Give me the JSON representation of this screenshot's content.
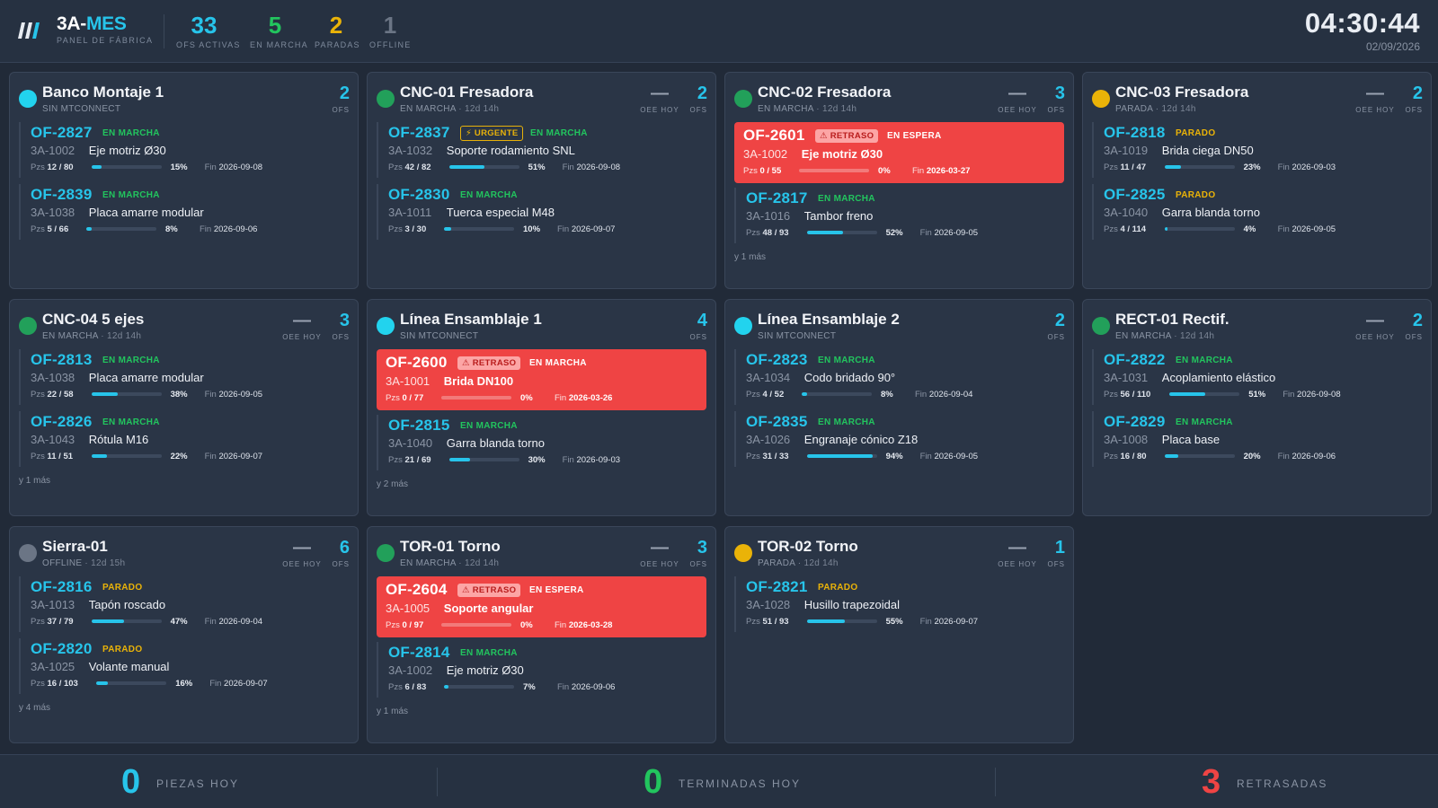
{
  "header": {
    "brand_prefix": "3A-",
    "brand_suffix": "MES",
    "subtitle": "PANEL DE FÁBRICA",
    "stats": [
      {
        "value": "33",
        "label": "OFS ACTIVAS",
        "color": "#27c4ea"
      },
      {
        "value": "5",
        "label": "EN MARCHA",
        "color": "#22c55e"
      },
      {
        "value": "2",
        "label": "PARADAS",
        "color": "#eab308"
      },
      {
        "value": "1",
        "label": "OFFLINE",
        "color": "#6b7585"
      }
    ],
    "clock": "04:30:44",
    "date": "02/09/2026"
  },
  "colors": {
    "accent": "#27c4ea",
    "running": "#22c55e",
    "stopped": "#eab308",
    "offline": "#6b7585",
    "late": "#ef4444",
    "no_mtconnect": "#22d3ee"
  },
  "machines": [
    {
      "name": "Banco Montaje 1",
      "state": "SIN MTCONNECT",
      "uptime": "",
      "dot": "#22d3ee",
      "oee": "",
      "oee_label": "",
      "ofs": "2",
      "ofs_label": "OFS",
      "orders": [
        {
          "id": "OF-2827",
          "tag": "",
          "status": "EN MARCHA",
          "ref": "3A-1002",
          "desc": "Eje motriz Ø30",
          "pzs_label": "Pzs",
          "pzs": "12 / 80",
          "progress": 15,
          "pct": "15%",
          "fin_label": "Fin",
          "fin": "2026-09-08",
          "late": false
        },
        {
          "id": "OF-2839",
          "tag": "",
          "status": "EN MARCHA",
          "ref": "3A-1038",
          "desc": "Placa amarre modular",
          "pzs_label": "Pzs",
          "pzs": "5 / 66",
          "progress": 8,
          "pct": "8%",
          "fin_label": "Fin",
          "fin": "2026-09-06",
          "late": false
        }
      ],
      "more": ""
    },
    {
      "name": "CNC-01 Fresadora",
      "state": "EN MARCHA",
      "uptime": "12d 14h",
      "dot": "#22a05a",
      "oee": "—",
      "oee_label": "OEE HOY",
      "ofs": "2",
      "ofs_label": "OFS",
      "orders": [
        {
          "id": "OF-2837",
          "tag": "⚡ URGENTE",
          "status": "EN MARCHA",
          "ref": "3A-1032",
          "desc": "Soporte rodamiento SNL",
          "pzs_label": "Pzs",
          "pzs": "42 / 82",
          "progress": 51,
          "pct": "51%",
          "fin_label": "Fin",
          "fin": "2026-09-08",
          "late": false
        },
        {
          "id": "OF-2830",
          "tag": "",
          "status": "EN MARCHA",
          "ref": "3A-1011",
          "desc": "Tuerca especial M48",
          "pzs_label": "Pzs",
          "pzs": "3 / 30",
          "progress": 10,
          "pct": "10%",
          "fin_label": "Fin",
          "fin": "2026-09-07",
          "late": false
        }
      ],
      "more": ""
    },
    {
      "name": "CNC-02 Fresadora",
      "state": "EN MARCHA",
      "uptime": "12d 14h",
      "dot": "#22a05a",
      "oee": "—",
      "oee_label": "OEE HOY",
      "ofs": "3",
      "ofs_label": "OFS",
      "orders": [
        {
          "id": "OF-2601",
          "tag": "⚠ RETRASO",
          "status": "EN ESPERA",
          "ref": "3A-1002",
          "desc": "Eje motriz Ø30",
          "pzs_label": "Pzs",
          "pzs": "0 / 55",
          "progress": 0,
          "pct": "0%",
          "fin_label": "Fin",
          "fin": "2026-03-27",
          "late": true
        },
        {
          "id": "OF-2817",
          "tag": "",
          "status": "EN MARCHA",
          "ref": "3A-1016",
          "desc": "Tambor freno",
          "pzs_label": "Pzs",
          "pzs": "48 / 93",
          "progress": 52,
          "pct": "52%",
          "fin_label": "Fin",
          "fin": "2026-09-05",
          "late": false
        }
      ],
      "more": "y 1 más"
    },
    {
      "name": "CNC-03 Fresadora",
      "state": "PARADA",
      "uptime": "12d 14h",
      "dot": "#eab308",
      "oee": "—",
      "oee_label": "OEE HOY",
      "ofs": "2",
      "ofs_label": "OFS",
      "orders": [
        {
          "id": "OF-2818",
          "tag": "",
          "status": "PARADO",
          "ref": "3A-1019",
          "desc": "Brida ciega DN50",
          "pzs_label": "Pzs",
          "pzs": "11 / 47",
          "progress": 23,
          "pct": "23%",
          "fin_label": "Fin",
          "fin": "2026-09-03",
          "late": false
        },
        {
          "id": "OF-2825",
          "tag": "",
          "status": "PARADO",
          "ref": "3A-1040",
          "desc": "Garra blanda torno",
          "pzs_label": "Pzs",
          "pzs": "4 / 114",
          "progress": 4,
          "pct": "4%",
          "fin_label": "Fin",
          "fin": "2026-09-05",
          "late": false
        }
      ],
      "more": ""
    },
    {
      "name": "CNC-04 5 ejes",
      "state": "EN MARCHA",
      "uptime": "12d 14h",
      "dot": "#22a05a",
      "oee": "—",
      "oee_label": "OEE HOY",
      "ofs": "3",
      "ofs_label": "OFS",
      "orders": [
        {
          "id": "OF-2813",
          "tag": "",
          "status": "EN MARCHA",
          "ref": "3A-1038",
          "desc": "Placa amarre modular",
          "pzs_label": "Pzs",
          "pzs": "22 / 58",
          "progress": 38,
          "pct": "38%",
          "fin_label": "Fin",
          "fin": "2026-09-05",
          "late": false
        },
        {
          "id": "OF-2826",
          "tag": "",
          "status": "EN MARCHA",
          "ref": "3A-1043",
          "desc": "Rótula M16",
          "pzs_label": "Pzs",
          "pzs": "11 / 51",
          "progress": 22,
          "pct": "22%",
          "fin_label": "Fin",
          "fin": "2026-09-07",
          "late": false
        }
      ],
      "more": "y 1 más"
    },
    {
      "name": "Línea Ensamblaje 1",
      "state": "SIN MTCONNECT",
      "uptime": "",
      "dot": "#22d3ee",
      "oee": "",
      "oee_label": "",
      "ofs": "4",
      "ofs_label": "OFS",
      "orders": [
        {
          "id": "OF-2600",
          "tag": "⚠ RETRASO",
          "status": "EN MARCHA",
          "ref": "3A-1001",
          "desc": "Brida DN100",
          "pzs_label": "Pzs",
          "pzs": "0 / 77",
          "progress": 0,
          "pct": "0%",
          "fin_label": "Fin",
          "fin": "2026-03-26",
          "late": true
        },
        {
          "id": "OF-2815",
          "tag": "",
          "status": "EN MARCHA",
          "ref": "3A-1040",
          "desc": "Garra blanda torno",
          "pzs_label": "Pzs",
          "pzs": "21 / 69",
          "progress": 30,
          "pct": "30%",
          "fin_label": "Fin",
          "fin": "2026-09-03",
          "late": false
        }
      ],
      "more": "y 2 más"
    },
    {
      "name": "Línea Ensamblaje 2",
      "state": "SIN MTCONNECT",
      "uptime": "",
      "dot": "#22d3ee",
      "oee": "",
      "oee_label": "",
      "ofs": "2",
      "ofs_label": "OFS",
      "orders": [
        {
          "id": "OF-2823",
          "tag": "",
          "status": "EN MARCHA",
          "ref": "3A-1034",
          "desc": "Codo bridado 90°",
          "pzs_label": "Pzs",
          "pzs": "4 / 52",
          "progress": 8,
          "pct": "8%",
          "fin_label": "Fin",
          "fin": "2026-09-04",
          "late": false
        },
        {
          "id": "OF-2835",
          "tag": "",
          "status": "EN MARCHA",
          "ref": "3A-1026",
          "desc": "Engranaje cónico Z18",
          "pzs_label": "Pzs",
          "pzs": "31 / 33",
          "progress": 94,
          "pct": "94%",
          "fin_label": "Fin",
          "fin": "2026-09-05",
          "late": false
        }
      ],
      "more": ""
    },
    {
      "name": "RECT-01 Rectif.",
      "state": "EN MARCHA",
      "uptime": "12d 14h",
      "dot": "#22a05a",
      "oee": "—",
      "oee_label": "OEE HOY",
      "ofs": "2",
      "ofs_label": "OFS",
      "orders": [
        {
          "id": "OF-2822",
          "tag": "",
          "status": "EN MARCHA",
          "ref": "3A-1031",
          "desc": "Acoplamiento elástico",
          "pzs_label": "Pzs",
          "pzs": "56 / 110",
          "progress": 51,
          "pct": "51%",
          "fin_label": "Fin",
          "fin": "2026-09-08",
          "late": false
        },
        {
          "id": "OF-2829",
          "tag": "",
          "status": "EN MARCHA",
          "ref": "3A-1008",
          "desc": "Placa base",
          "pzs_label": "Pzs",
          "pzs": "16 / 80",
          "progress": 20,
          "pct": "20%",
          "fin_label": "Fin",
          "fin": "2026-09-06",
          "late": false
        }
      ],
      "more": ""
    },
    {
      "name": "Sierra-01",
      "state": "OFFLINE",
      "uptime": "12d 15h",
      "dot": "#6b7585",
      "oee": "—",
      "oee_label": "OEE HOY",
      "ofs": "6",
      "ofs_label": "OFS",
      "orders": [
        {
          "id": "OF-2816",
          "tag": "",
          "status": "PARADO",
          "ref": "3A-1013",
          "desc": "Tapón roscado",
          "pzs_label": "Pzs",
          "pzs": "37 / 79",
          "progress": 47,
          "pct": "47%",
          "fin_label": "Fin",
          "fin": "2026-09-04",
          "late": false
        },
        {
          "id": "OF-2820",
          "tag": "",
          "status": "PARADO",
          "ref": "3A-1025",
          "desc": "Volante manual",
          "pzs_label": "Pzs",
          "pzs": "16 / 103",
          "progress": 16,
          "pct": "16%",
          "fin_label": "Fin",
          "fin": "2026-09-07",
          "late": false
        }
      ],
      "more": "y 4 más"
    },
    {
      "name": "TOR-01 Torno",
      "state": "EN MARCHA",
      "uptime": "12d 14h",
      "dot": "#22a05a",
      "oee": "—",
      "oee_label": "OEE HOY",
      "ofs": "3",
      "ofs_label": "OFS",
      "orders": [
        {
          "id": "OF-2604",
          "tag": "⚠ RETRASO",
          "status": "EN ESPERA",
          "ref": "3A-1005",
          "desc": "Soporte angular",
          "pzs_label": "Pzs",
          "pzs": "0 / 97",
          "progress": 0,
          "pct": "0%",
          "fin_label": "Fin",
          "fin": "2026-03-28",
          "late": true
        },
        {
          "id": "OF-2814",
          "tag": "",
          "status": "EN MARCHA",
          "ref": "3A-1002",
          "desc": "Eje motriz Ø30",
          "pzs_label": "Pzs",
          "pzs": "6 / 83",
          "progress": 7,
          "pct": "7%",
          "fin_label": "Fin",
          "fin": "2026-09-06",
          "late": false
        }
      ],
      "more": "y 1 más"
    },
    {
      "name": "TOR-02 Torno",
      "state": "PARADA",
      "uptime": "12d 14h",
      "dot": "#eab308",
      "oee": "—",
      "oee_label": "OEE HOY",
      "ofs": "1",
      "ofs_label": "OFS",
      "orders": [
        {
          "id": "OF-2821",
          "tag": "",
          "status": "PARADO",
          "ref": "3A-1028",
          "desc": "Husillo trapezoidal",
          "pzs_label": "Pzs",
          "pzs": "51 / 93",
          "progress": 55,
          "pct": "55%",
          "fin_label": "Fin",
          "fin": "2026-09-07",
          "late": false
        }
      ],
      "more": ""
    }
  ],
  "footer": [
    {
      "value": "0",
      "label": "PIEZAS HOY",
      "color": "#27c4ea"
    },
    {
      "value": "0",
      "label": "TERMINADAS HOY",
      "color": "#22c55e"
    },
    {
      "value": "3",
      "label": "RETRASADAS",
      "color": "#ef4444"
    }
  ]
}
